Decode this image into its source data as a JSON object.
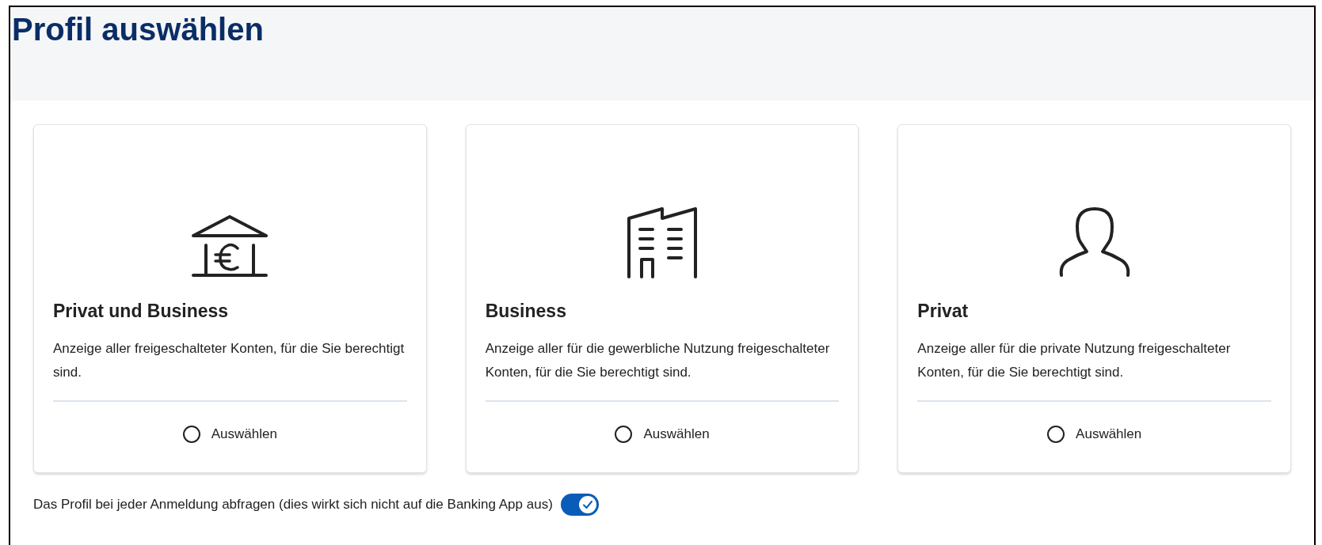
{
  "title": "Profil auswählen",
  "profiles": [
    {
      "kind": "bank",
      "name": "Privat und Business",
      "description": "Anzeige aller freigeschalteter Konten, für die Sie berechtigt sind.",
      "option": "Auswählen",
      "selected": false
    },
    {
      "kind": "building",
      "name": "Business",
      "description": "Anzeige aller für die gewerbliche Nutzung freigeschalteter Konten, für die Sie berechtigt sind.",
      "option": "Auswählen",
      "selected": false
    },
    {
      "kind": "person",
      "name": "Privat",
      "description": "Anzeige aller für die private Nutzung freigeschalteter Konten, für die Sie berechtigt sind.",
      "option": "Auswählen",
      "selected": false
    }
  ],
  "ask_profile": {
    "label": "Das Profil bei jeder Anmeldung abfragen (dies wirkt sich nicht auf die Banking App aus)",
    "on": true
  }
}
